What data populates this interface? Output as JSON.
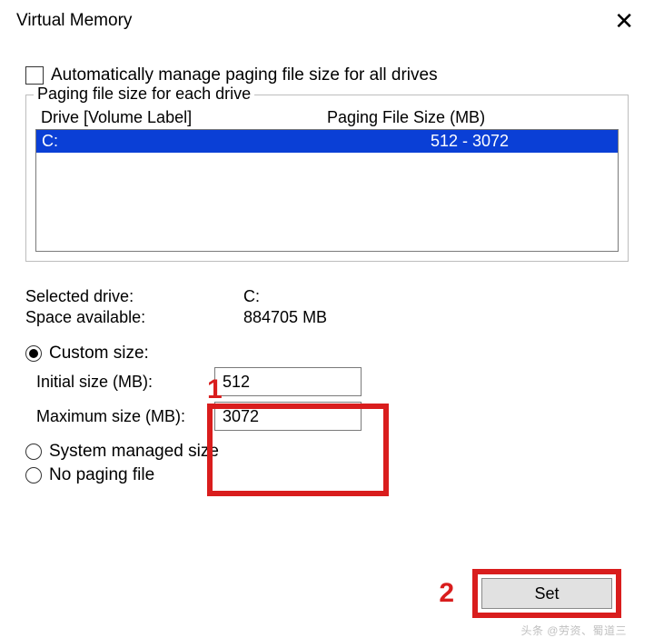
{
  "window": {
    "title": "Virtual Memory"
  },
  "auto_manage": {
    "label": "Automatically manage paging file size for all drives"
  },
  "group": {
    "label": "Paging file size for each drive",
    "headers": {
      "drive": "Drive  [Volume Label]",
      "size": "Paging File Size (MB)"
    },
    "rows": [
      {
        "drive": "C:",
        "size": "512 - 3072"
      }
    ]
  },
  "info": {
    "selected_drive_label": "Selected drive:",
    "selected_drive_value": "C:",
    "space_available_label": "Space available:",
    "space_available_value": "884705 MB"
  },
  "options": {
    "custom_label": "Custom size:",
    "initial_label": "Initial size (MB):",
    "initial_value": "512",
    "maximum_label": "Maximum size (MB):",
    "maximum_value": "3072",
    "system_managed_label": "System managed size",
    "no_paging_label": "No paging file"
  },
  "buttons": {
    "set": "Set"
  },
  "annotations": {
    "one": "1",
    "two": "2"
  },
  "watermark": "头条 @劳资、蜀道三"
}
